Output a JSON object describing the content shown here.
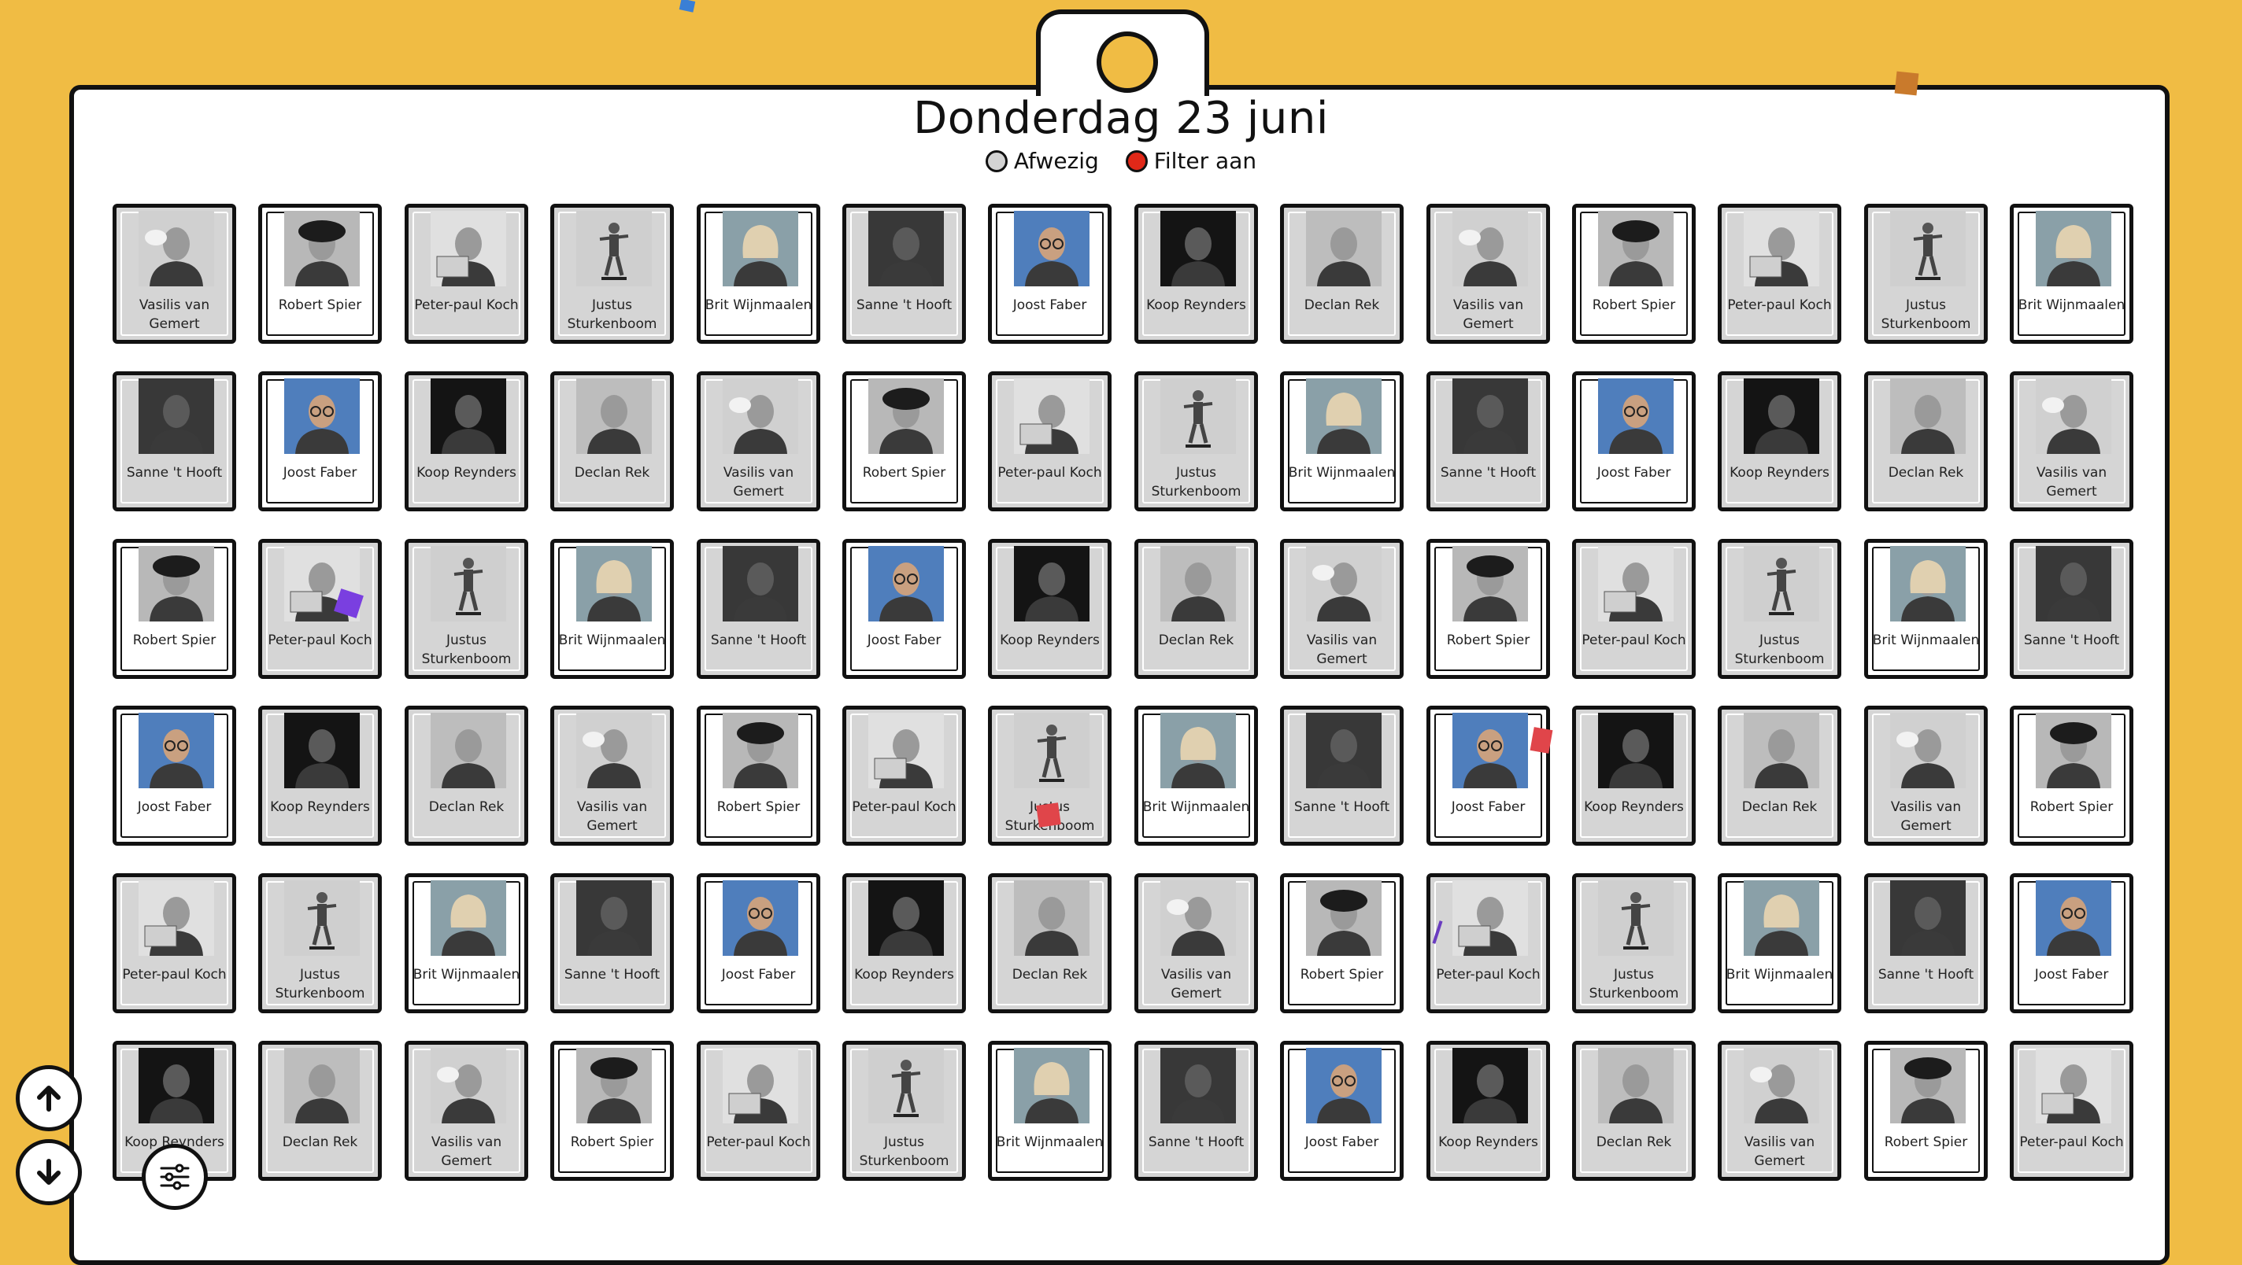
{
  "page": {
    "title": "Donderdag 23 juni",
    "legend": [
      {
        "label": "Afwezig",
        "color": "#D3D3D3"
      },
      {
        "label": "Filter aan",
        "color": "#E02818"
      }
    ]
  },
  "people": [
    {
      "name": "Vasilis van Gemert",
      "avatar": "hat-wave",
      "photo_bg": "#D0D0D0"
    },
    {
      "name": "Robert Spier",
      "avatar": "curly-hat",
      "photo_bg": "#B8B8B8"
    },
    {
      "name": "Peter-paul Koch",
      "avatar": "laptop",
      "photo_bg": "#E0E0E0"
    },
    {
      "name": "Justus Sturkenboom",
      "avatar": "skater",
      "photo_bg": "#CFCFCF"
    },
    {
      "name": "Brit Wijnmaalen",
      "avatar": "blonde",
      "photo_bg": "#8AA0A8"
    },
    {
      "name": "Sanne 't Hooft",
      "avatar": "dark-pose",
      "photo_bg": "#383838"
    },
    {
      "name": "Joost Faber",
      "avatar": "glasses-blue",
      "photo_bg": "#4F7EBC"
    },
    {
      "name": "Koop Reynders",
      "avatar": "bald-dark",
      "photo_bg": "#141414"
    },
    {
      "name": "Declan Rek",
      "avatar": "smile",
      "photo_bg": "#BDBDBD"
    }
  ],
  "rows": [
    [
      {
        "p": 0,
        "absent": true
      },
      {
        "p": 1,
        "absent": false
      },
      {
        "p": 2,
        "absent": true
      },
      {
        "p": 3,
        "absent": true
      },
      {
        "p": 4,
        "absent": false
      },
      {
        "p": 5,
        "absent": true
      },
      {
        "p": 6,
        "absent": false
      },
      {
        "p": 7,
        "absent": true
      },
      {
        "p": 8,
        "absent": true
      },
      {
        "p": 0,
        "absent": true
      },
      {
        "p": 1,
        "absent": false
      },
      {
        "p": 2,
        "absent": true
      },
      {
        "p": 3,
        "absent": true
      },
      {
        "p": 4,
        "absent": false
      }
    ],
    [
      {
        "p": 5,
        "absent": true
      },
      {
        "p": 6,
        "absent": false
      },
      {
        "p": 7,
        "absent": true
      },
      {
        "p": 8,
        "absent": true
      },
      {
        "p": 0,
        "absent": true
      },
      {
        "p": 1,
        "absent": false
      },
      {
        "p": 2,
        "absent": true
      },
      {
        "p": 3,
        "absent": true
      },
      {
        "p": 4,
        "absent": false
      },
      {
        "p": 5,
        "absent": true
      },
      {
        "p": 6,
        "absent": false
      },
      {
        "p": 7,
        "absent": true
      },
      {
        "p": 8,
        "absent": true
      },
      {
        "p": 0,
        "absent": true
      }
    ],
    [
      {
        "p": 1,
        "absent": false
      },
      {
        "p": 2,
        "absent": true
      },
      {
        "p": 3,
        "absent": true
      },
      {
        "p": 4,
        "absent": false
      },
      {
        "p": 5,
        "absent": true
      },
      {
        "p": 6,
        "absent": false
      },
      {
        "p": 7,
        "absent": true
      },
      {
        "p": 8,
        "absent": true
      },
      {
        "p": 0,
        "absent": true
      },
      {
        "p": 1,
        "absent": false
      },
      {
        "p": 2,
        "absent": true
      },
      {
        "p": 3,
        "absent": true
      },
      {
        "p": 4,
        "absent": false
      },
      {
        "p": 5,
        "absent": true
      }
    ],
    [
      {
        "p": 6,
        "absent": false
      },
      {
        "p": 7,
        "absent": true
      },
      {
        "p": 8,
        "absent": true
      },
      {
        "p": 0,
        "absent": true
      },
      {
        "p": 1,
        "absent": false
      },
      {
        "p": 2,
        "absent": true
      },
      {
        "p": 3,
        "absent": true
      },
      {
        "p": 4,
        "absent": false
      },
      {
        "p": 5,
        "absent": true
      },
      {
        "p": 6,
        "absent": false
      },
      {
        "p": 7,
        "absent": true
      },
      {
        "p": 8,
        "absent": true
      },
      {
        "p": 0,
        "absent": true
      },
      {
        "p": 1,
        "absent": false
      }
    ],
    [
      {
        "p": 2,
        "absent": true
      },
      {
        "p": 3,
        "absent": true
      },
      {
        "p": 4,
        "absent": false
      },
      {
        "p": 5,
        "absent": true
      },
      {
        "p": 6,
        "absent": false
      },
      {
        "p": 7,
        "absent": true
      },
      {
        "p": 8,
        "absent": true
      },
      {
        "p": 0,
        "absent": true
      },
      {
        "p": 1,
        "absent": false
      },
      {
        "p": 2,
        "absent": true
      },
      {
        "p": 3,
        "absent": true
      },
      {
        "p": 4,
        "absent": false
      },
      {
        "p": 5,
        "absent": true
      },
      {
        "p": 6,
        "absent": false
      }
    ],
    [
      {
        "p": 7,
        "absent": true
      },
      {
        "p": 8,
        "absent": true
      },
      {
        "p": 0,
        "absent": true
      },
      {
        "p": 1,
        "absent": false
      },
      {
        "p": 2,
        "absent": true
      },
      {
        "p": 3,
        "absent": true
      },
      {
        "p": 4,
        "absent": false
      },
      {
        "p": 5,
        "absent": true
      },
      {
        "p": 6,
        "absent": false
      },
      {
        "p": 7,
        "absent": true
      },
      {
        "p": 8,
        "absent": true
      },
      {
        "p": 0,
        "absent": true
      },
      {
        "p": 1,
        "absent": false
      },
      {
        "p": 2,
        "absent": true
      }
    ]
  ],
  "controls": {
    "scroll_up_icon": "arrow-up-icon",
    "scroll_down_icon": "arrow-down-icon",
    "filter_icon": "sliders-icon"
  },
  "colors": {
    "background": "#F0BC44",
    "board": "#FFFFFF",
    "outline": "#111111",
    "absent_card": "#D5D5D5",
    "confetti": [
      "#3A7FD5",
      "#C97A2C",
      "#7A3FE0",
      "#E0454A",
      "#E0454A",
      "#6A3CC0"
    ]
  }
}
